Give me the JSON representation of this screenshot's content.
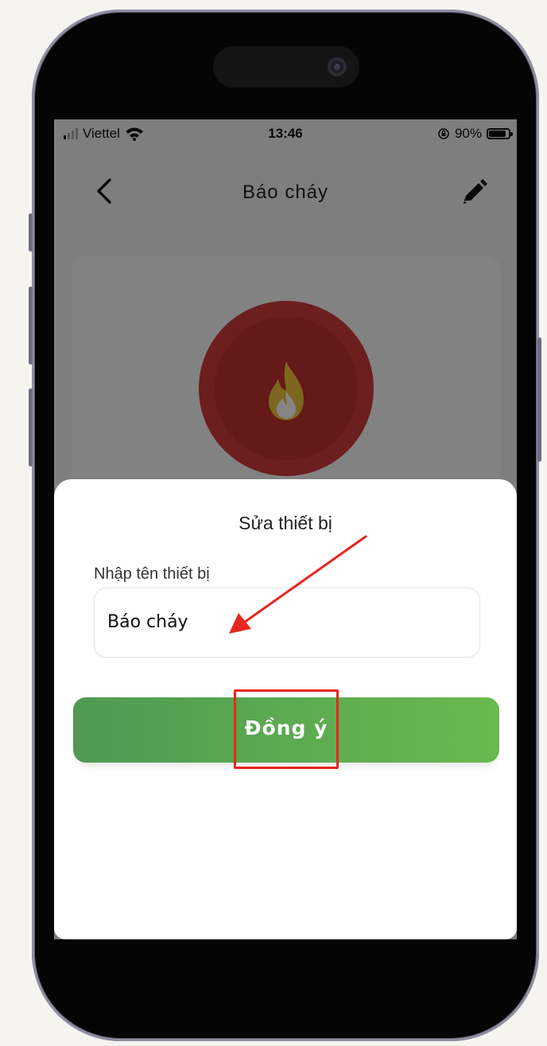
{
  "status_bar": {
    "carrier": "Viettel",
    "time": "13:46",
    "battery": "90%",
    "icons": [
      "signal-icon",
      "wifi-icon",
      "rotation-lock-icon",
      "battery-icon"
    ]
  },
  "nav": {
    "title": "Báo cháy",
    "back_icon": "chevron-left-icon",
    "edit_icon": "pencil-icon"
  },
  "device_card": {
    "icon": "fire-icon",
    "colors": {
      "outer": "#d23b3b",
      "inner": "#c1302f",
      "flame": "#f0c43a"
    }
  },
  "dialog": {
    "title": "Sửa thiết bị",
    "field_label": "Nhập tên thiết bị",
    "field_value": "Báo cháy",
    "confirm_label": "Đồng ý"
  },
  "annotations": {
    "color": "#e8261f"
  },
  "colors": {
    "button_green": "#5aa851"
  }
}
